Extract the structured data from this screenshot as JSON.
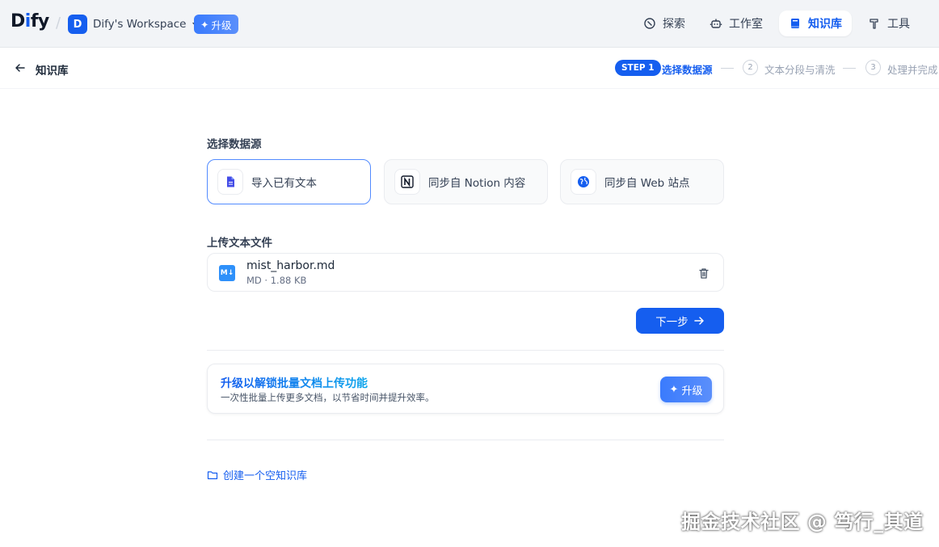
{
  "app": {
    "logo_main": "D",
    "logo_accent": "i",
    "logo_rest": "fy",
    "workspace_avatar": "D",
    "workspace_name": "Dify's Workspace",
    "upgrade_label": "升级"
  },
  "nav": {
    "explore": "探索",
    "studio": "工作室",
    "knowledge": "知识库",
    "tools": "工具"
  },
  "subheader": {
    "title": "知识库",
    "steps": [
      {
        "badge": "STEP 1",
        "label": "选择数据源"
      },
      {
        "num": "2",
        "label": "文本分段与清洗"
      },
      {
        "num": "3",
        "label": "处理并完成"
      }
    ]
  },
  "datasource": {
    "section_title": "选择数据源",
    "options": [
      {
        "label": "导入已有文本",
        "icon": "file-text-icon",
        "selected": true
      },
      {
        "label": "同步自 Notion 内容",
        "icon": "notion-icon",
        "selected": false
      },
      {
        "label": "同步自 Web 站点",
        "icon": "globe-icon",
        "selected": false
      }
    ]
  },
  "upload": {
    "section_title": "上传文本文件",
    "file": {
      "type_badge": "M↓",
      "name": "mist_harbor.md",
      "meta": "MD · 1.88 KB"
    },
    "next_label": "下一步"
  },
  "upsell": {
    "title": "升级以解锁批量文档上传功能",
    "subtitle": "一次性批量上传更多文档，以节省时间并提升效率。",
    "button_label": "升级"
  },
  "create_empty_label": "创建一个空知识库",
  "watermark": "掘金技术社区 @ 笃行_其道",
  "colors": {
    "primary": "#155eef",
    "topbar_bg": "#f2f4f7",
    "border": "#eaecf0",
    "muted_text": "#98a2b3"
  }
}
